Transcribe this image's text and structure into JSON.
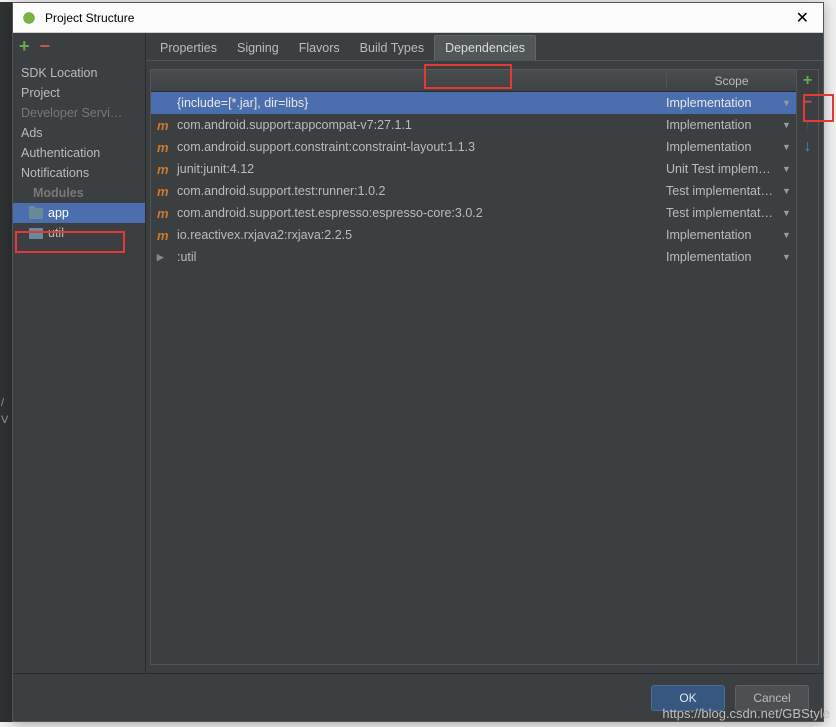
{
  "window": {
    "title": "Project Structure",
    "close_glyph": "✕"
  },
  "sidebar": {
    "items": [
      {
        "label": "SDK Location",
        "type": "item"
      },
      {
        "label": "Project",
        "type": "item"
      },
      {
        "label": "Developer Servi…",
        "type": "item",
        "dim": true
      },
      {
        "label": "Ads",
        "type": "item"
      },
      {
        "label": "Authentication",
        "type": "item"
      },
      {
        "label": "Notifications",
        "type": "item"
      },
      {
        "label": "Modules",
        "type": "header"
      },
      {
        "label": "app",
        "type": "module",
        "selected": true,
        "icon": "folder"
      },
      {
        "label": "util",
        "type": "module",
        "icon": "util"
      }
    ]
  },
  "tabs": [
    {
      "label": "Properties",
      "active": false
    },
    {
      "label": "Signing",
      "active": false
    },
    {
      "label": "Flavors",
      "active": false
    },
    {
      "label": "Build Types",
      "active": false
    },
    {
      "label": "Dependencies",
      "active": true
    }
  ],
  "table": {
    "scope_header": "Scope",
    "rows": [
      {
        "icon": "",
        "name": "{include=[*.jar], dir=libs}",
        "scope": "Implementation",
        "selected": true
      },
      {
        "icon": "m",
        "name": "com.android.support:appcompat-v7:27.1.1",
        "scope": "Implementation"
      },
      {
        "icon": "m",
        "name": "com.android.support.constraint:constraint-layout:1.1.3",
        "scope": "Implementation"
      },
      {
        "icon": "m",
        "name": "junit:junit:4.12",
        "scope": "Unit Test implem…"
      },
      {
        "icon": "m",
        "name": "com.android.support.test:runner:1.0.2",
        "scope": "Test implementat…"
      },
      {
        "icon": "m",
        "name": "com.android.support.test.espresso:espresso-core:3.0.2",
        "scope": "Test implementat…"
      },
      {
        "icon": "m",
        "name": "io.reactivex.rxjava2:rxjava:2.2.5",
        "scope": "Implementation"
      },
      {
        "icon": "folder",
        "name": ":util",
        "scope": "Implementation"
      }
    ]
  },
  "footer": {
    "ok": "OK",
    "cancel": "Cancel"
  },
  "watermark": "https://blog.csdn.net/GBStyle",
  "hint1": "/",
  "hint2": "V"
}
